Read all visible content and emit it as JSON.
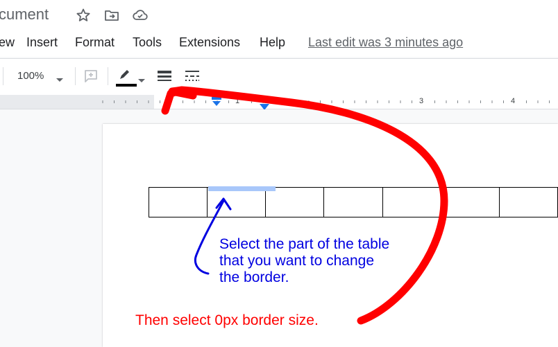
{
  "header": {
    "doc_title": "cument",
    "icons": [
      "star-icon",
      "move-to-folder-icon",
      "cloud-saved-icon"
    ]
  },
  "menu": {
    "items": [
      "ew",
      "Insert",
      "Format",
      "Tools",
      "Extensions",
      "Help"
    ],
    "last_edit": "Last edit was 3 minutes ago"
  },
  "toolbar": {
    "zoom": "100%",
    "icons": [
      "add-comment-icon",
      "border-color-icon",
      "border-width-icon",
      "border-dash-icon"
    ],
    "border_color": "#000000"
  },
  "ruler": {
    "labels": [
      "1",
      "3",
      "4"
    ],
    "marker_color": "#1a73e8"
  },
  "table": {
    "columns": 7,
    "rows": 1
  },
  "annotations": {
    "blue_text": [
      "Select the part of the table",
      "that you want to change",
      "the border."
    ],
    "red_text": "Then select 0px border size.",
    "blue_color": "#0000e0",
    "red_color": "#ff0000"
  }
}
